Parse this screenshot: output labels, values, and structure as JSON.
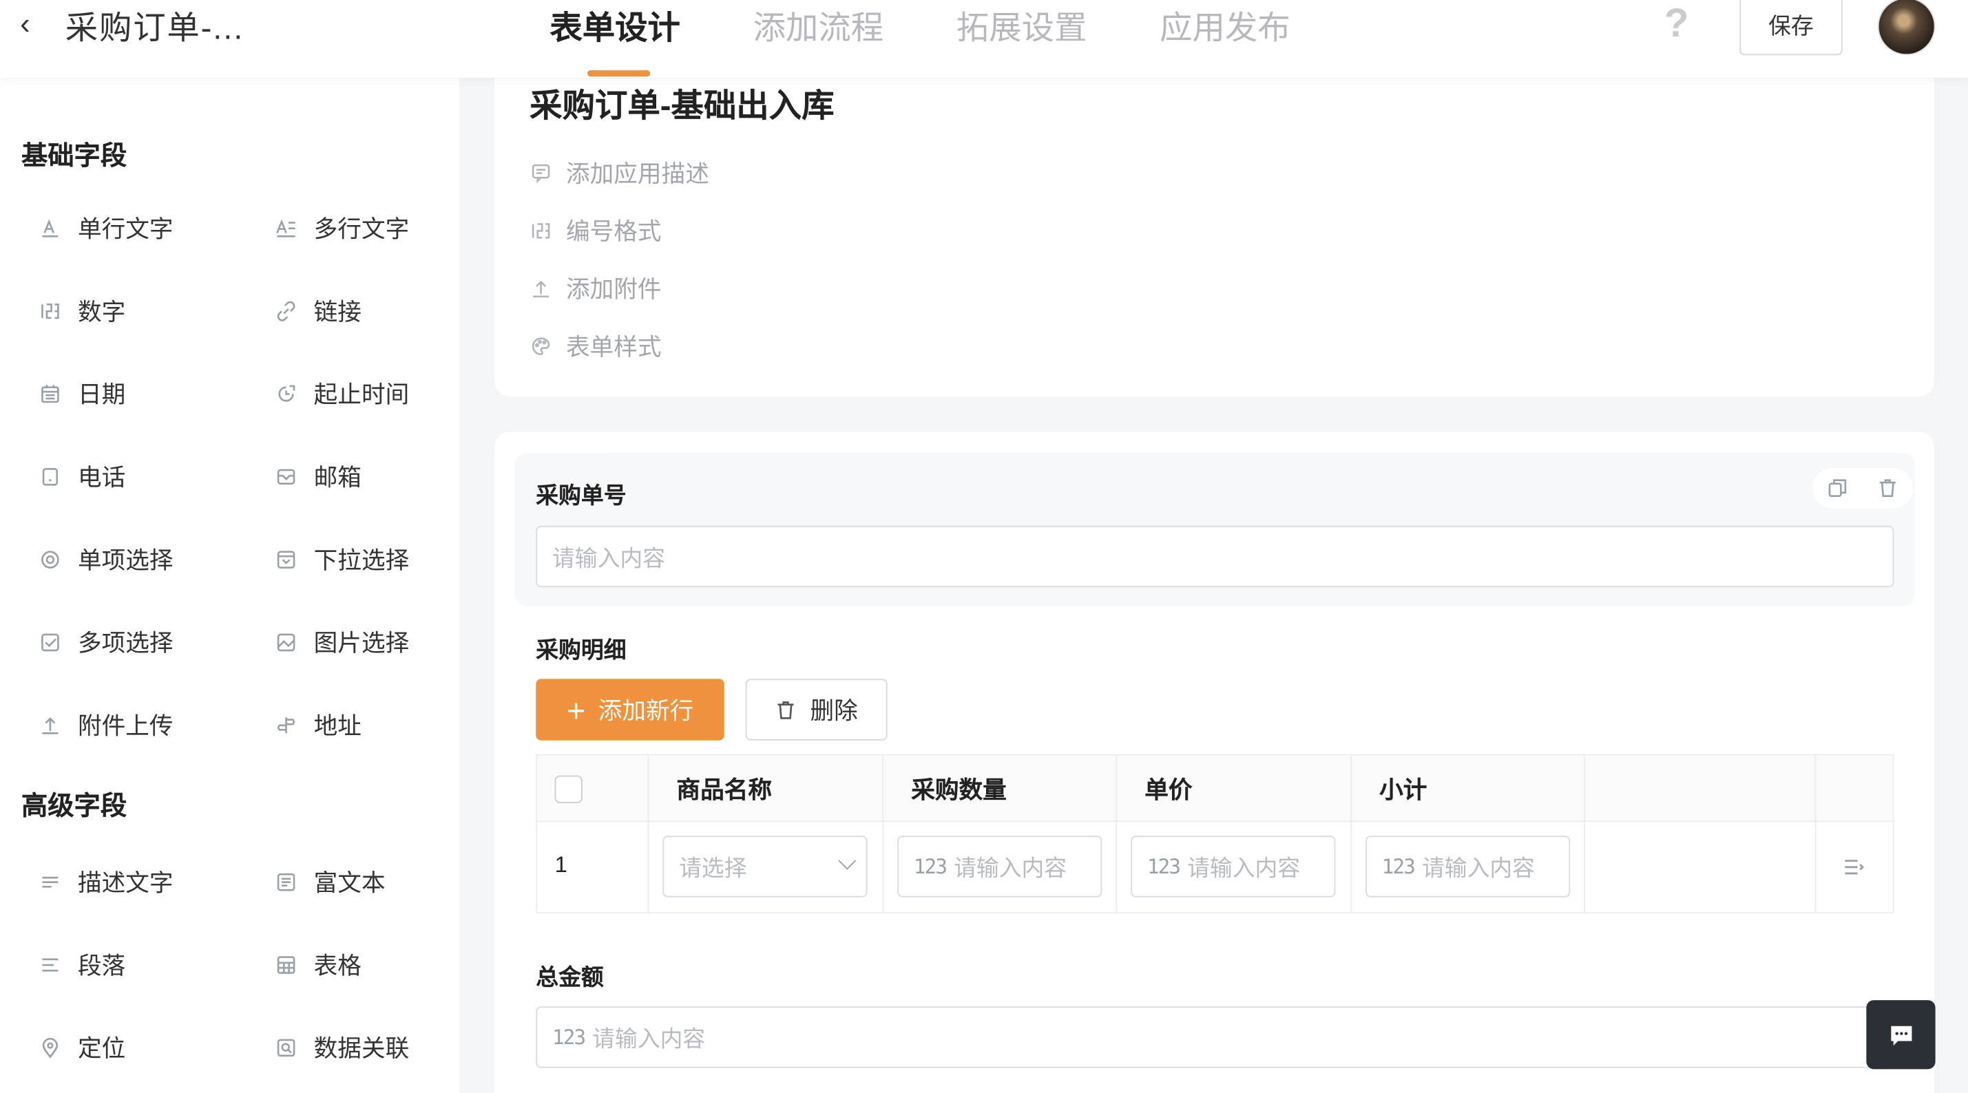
{
  "header": {
    "back_icon": "chevron-left-icon",
    "app_title": "采购订单-...",
    "tabs": [
      {
        "label": "表单设计",
        "active": true
      },
      {
        "label": "添加流程",
        "active": false
      },
      {
        "label": "拓展设置",
        "active": false
      },
      {
        "label": "应用发布",
        "active": false
      }
    ],
    "help_label": "?",
    "save_label": "保存",
    "accent_color": "#f0913d"
  },
  "sidebar": {
    "basic_title": "基础字段",
    "basic_fields": [
      {
        "label": "单行文字",
        "icon": "single-line-text-icon"
      },
      {
        "label": "多行文字",
        "icon": "multi-line-text-icon"
      },
      {
        "label": "数字",
        "icon": "number-icon"
      },
      {
        "label": "链接",
        "icon": "link-icon"
      },
      {
        "label": "日期",
        "icon": "calendar-icon"
      },
      {
        "label": "起止时间",
        "icon": "time-range-icon"
      },
      {
        "label": "电话",
        "icon": "phone-icon"
      },
      {
        "label": "邮箱",
        "icon": "mail-icon"
      },
      {
        "label": "单项选择",
        "icon": "radio-icon"
      },
      {
        "label": "下拉选择",
        "icon": "dropdown-icon"
      },
      {
        "label": "多项选择",
        "icon": "checkbox-icon"
      },
      {
        "label": "图片选择",
        "icon": "image-icon"
      },
      {
        "label": "附件上传",
        "icon": "upload-icon"
      },
      {
        "label": "地址",
        "icon": "signpost-icon"
      }
    ],
    "advanced_title": "高级字段",
    "advanced_fields": [
      {
        "label": "描述文字",
        "icon": "description-icon"
      },
      {
        "label": "富文本",
        "icon": "rich-text-icon"
      },
      {
        "label": "段落",
        "icon": "paragraph-icon"
      },
      {
        "label": "表格",
        "icon": "table-icon"
      },
      {
        "label": "定位",
        "icon": "location-icon"
      },
      {
        "label": "数据关联",
        "icon": "data-link-icon"
      }
    ]
  },
  "form": {
    "name": "采购订单-基础出入库",
    "options": [
      {
        "label": "添加应用描述",
        "icon": "comment-icon"
      },
      {
        "label": "编号格式",
        "icon": "number-format-icon"
      },
      {
        "label": "添加附件",
        "icon": "upload-icon"
      },
      {
        "label": "表单样式",
        "icon": "palette-icon"
      }
    ],
    "order_no_label": "采购单号",
    "order_no_placeholder": "请输入内容",
    "detail_label": "采购明细",
    "add_row_label": "添加新行",
    "delete_label": "删除",
    "table": {
      "columns": [
        "商品名称",
        "采购数量",
        "单价",
        "小计"
      ],
      "rows": [
        {
          "index": "1",
          "product_placeholder": "请选择",
          "qty_placeholder": "请输入内容",
          "price_placeholder": "请输入内容",
          "subtotal_placeholder": "请输入内容"
        }
      ]
    },
    "number_icon_text": "123",
    "total_label": "总金额",
    "total_placeholder": "请输入内容"
  },
  "chat_icon": "chat-icon"
}
